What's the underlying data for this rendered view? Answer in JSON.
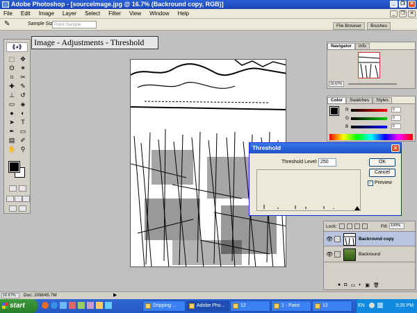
{
  "window": {
    "title": "Adobe Photoshop - [sourceImage.jpg @ 16.7% (Backround copy, RGB)]"
  },
  "menu": [
    "File",
    "Edit",
    "Image",
    "Layer",
    "Select",
    "Filter",
    "View",
    "Window",
    "Help"
  ],
  "options_bar": {
    "sample_size_label": "Sample Size:",
    "sample_size_value": "Point Sample"
  },
  "top_tabs": [
    "File Browser",
    "Brushes"
  ],
  "caption": "Image - Adjustments - Threshold",
  "navigator": {
    "tabs": [
      "Navigator",
      "Info"
    ],
    "zoom": "16.67%"
  },
  "color_panel": {
    "tabs": [
      "Color",
      "Swatches",
      "Styles"
    ],
    "channels": [
      "R",
      "G",
      "B"
    ],
    "values": [
      "0",
      "0",
      "0"
    ]
  },
  "threshold_dialog": {
    "title": "Threshold",
    "level_label": "Threshold Level:",
    "level_value": "250",
    "ok": "OK",
    "cancel": "Cancel",
    "preview_label": "Preview",
    "preview_checked": "✓"
  },
  "layers": {
    "lock_label": "Lock:",
    "fill_label": "Fill:",
    "fill_value": "100%",
    "items": [
      {
        "name": "Backround copy"
      },
      {
        "name": "Backround"
      }
    ]
  },
  "status_bar": {
    "zoom": "16.67%",
    "doc": "Doc: 20M/45.7M"
  },
  "taskbar": {
    "start": "start",
    "buttons": [
      "Dripping ...",
      "Adobe Pho...",
      "12",
      "1 - Paint",
      "12"
    ],
    "lang": "EN",
    "clock": "3:26 PM"
  },
  "colors": {
    "accent": "#2a5fd6",
    "taskbar": "#2457c4",
    "start": "#3c9a3c"
  }
}
